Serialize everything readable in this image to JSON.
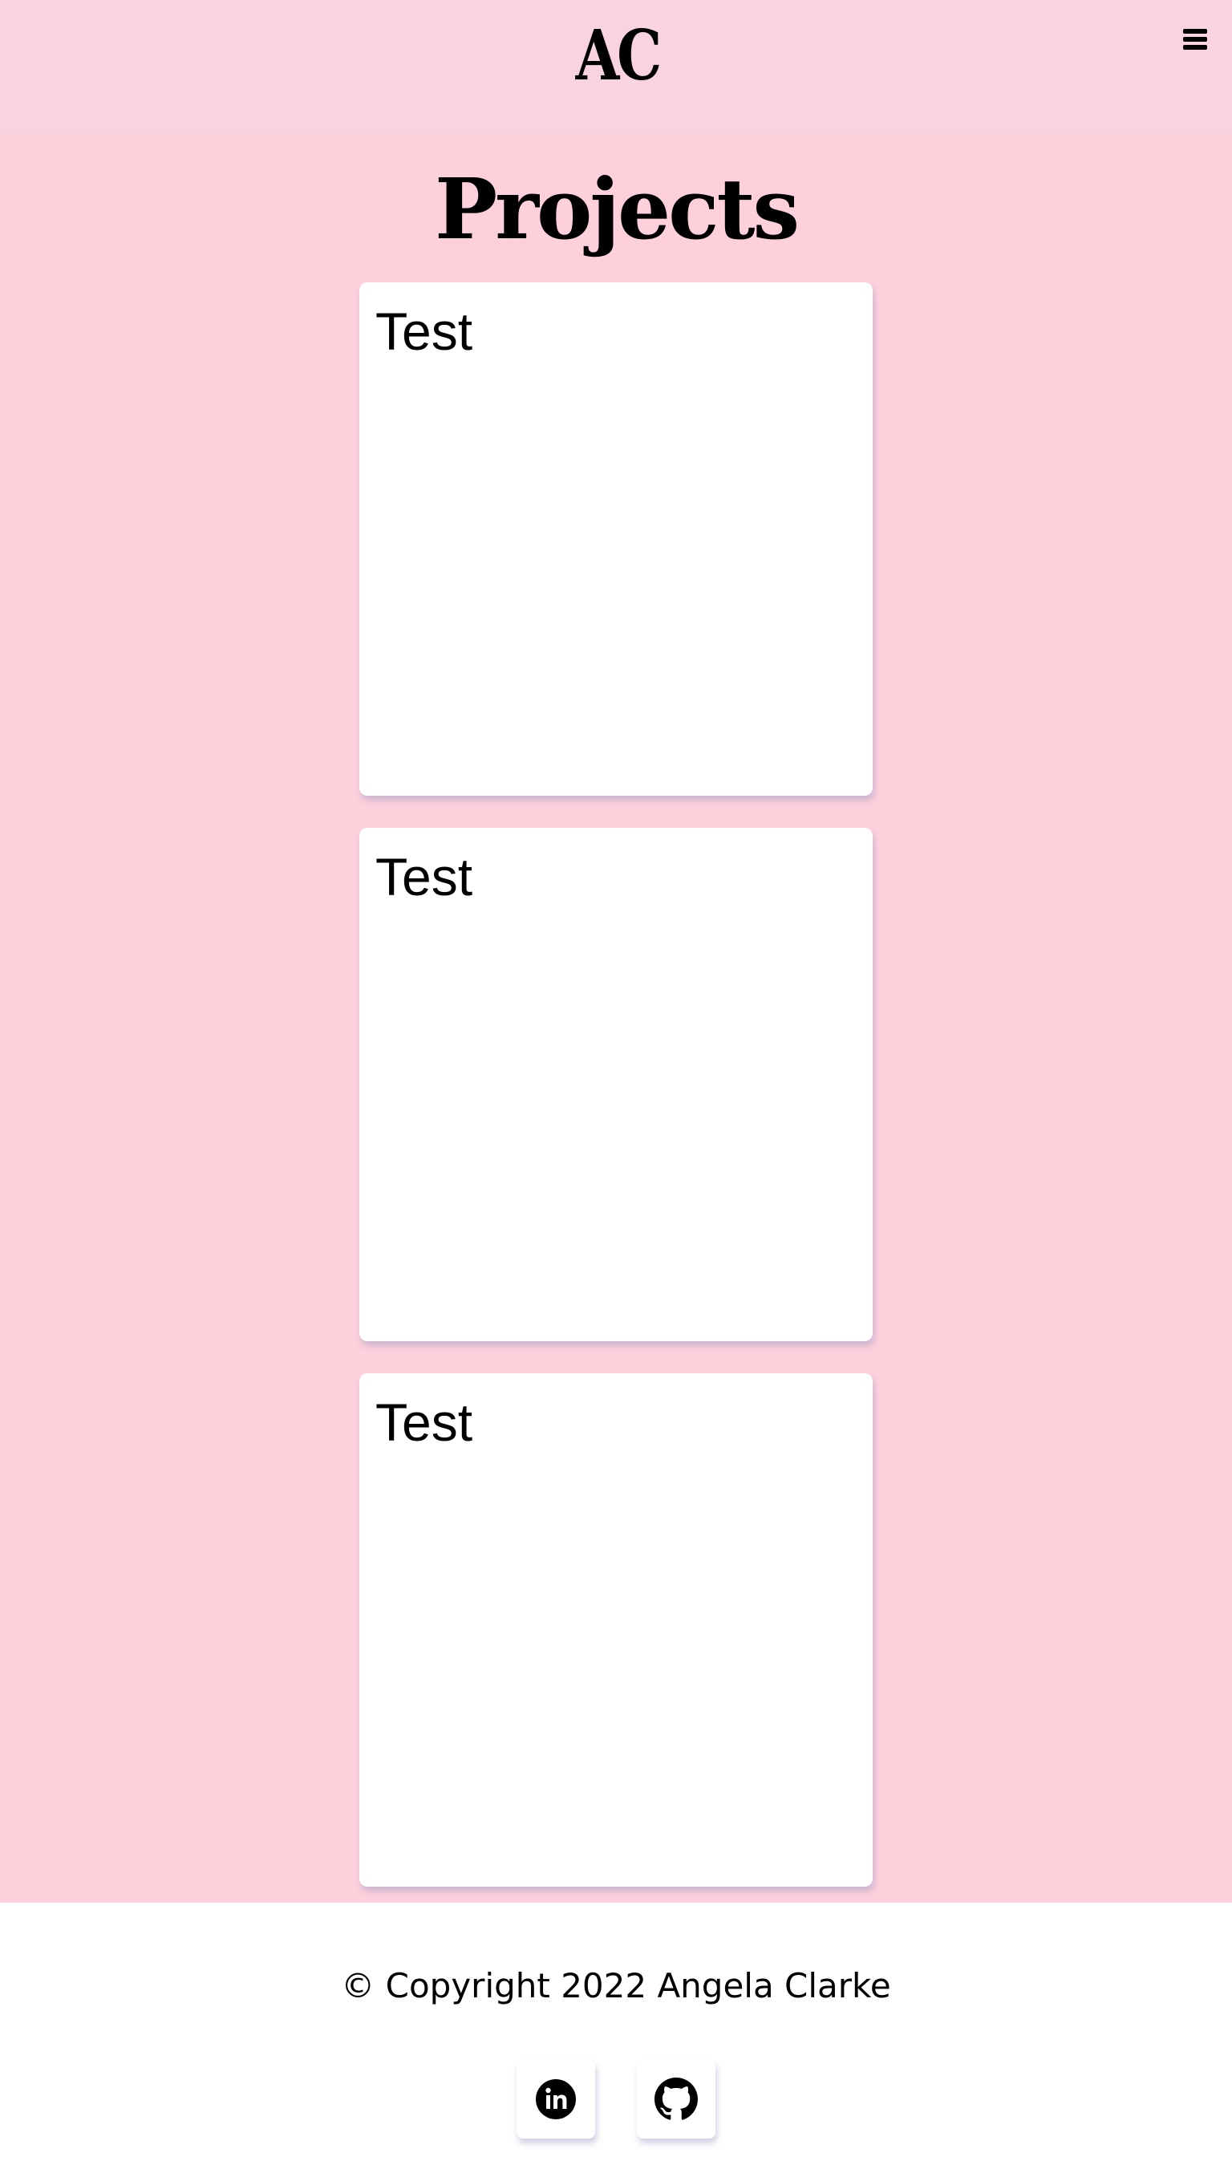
{
  "header": {
    "logo_text": "AC",
    "menu_icon": "hamburger-menu-icon"
  },
  "main": {
    "title": "Projects",
    "projects": [
      {
        "title": "Test"
      },
      {
        "title": "Test"
      },
      {
        "title": "Test"
      }
    ]
  },
  "footer": {
    "copyright": "© Copyright 2022 Angela Clarke",
    "social": [
      {
        "icon": "linkedin-icon"
      },
      {
        "icon": "github-icon"
      }
    ]
  },
  "colors": {
    "header_bg": "#f9d3df",
    "main_bg": "#fdd0dc",
    "card_bg": "#ffffff",
    "footer_bg": "#ffffff",
    "text": "#000000"
  }
}
